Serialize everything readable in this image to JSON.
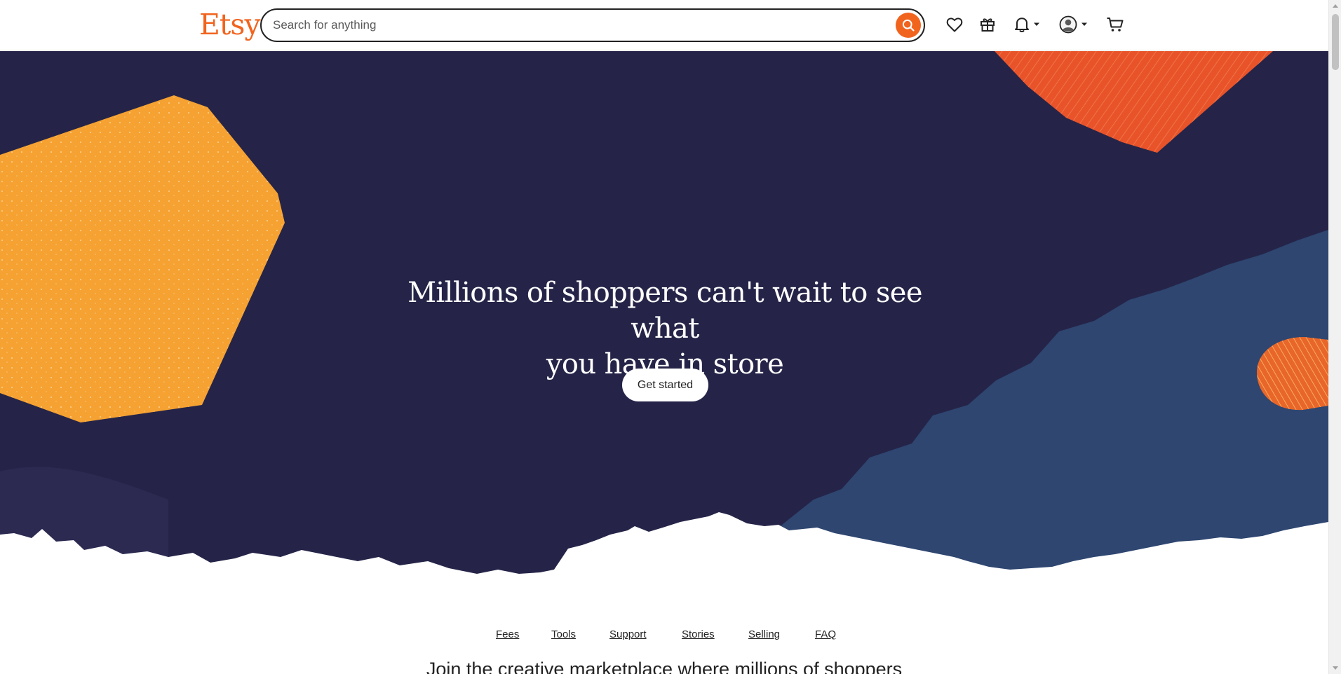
{
  "header": {
    "logo": "Etsy",
    "search_placeholder": "Search for anything",
    "icons": [
      "search-icon",
      "heart-icon",
      "gift-icon",
      "bell-icon",
      "caret-down-icon",
      "user-avatar-icon",
      "cart-icon"
    ]
  },
  "hero": {
    "title_line1": "Millions of shoppers can't wait to see what",
    "title_line2": "you have in store",
    "cta_label": "Get started"
  },
  "subnav": {
    "links": [
      "Fees",
      "Tools",
      "Support",
      "Stories",
      "Selling",
      "FAQ"
    ]
  },
  "section": {
    "heading_partial": "Join the creative marketplace where millions of shoppers"
  },
  "colors": {
    "brand": "#f1641e",
    "hero_bg": "#252448",
    "wave_blue": "#2e4670",
    "shape_yellow": "#f5a232",
    "shape_orange": "#e8532a"
  }
}
